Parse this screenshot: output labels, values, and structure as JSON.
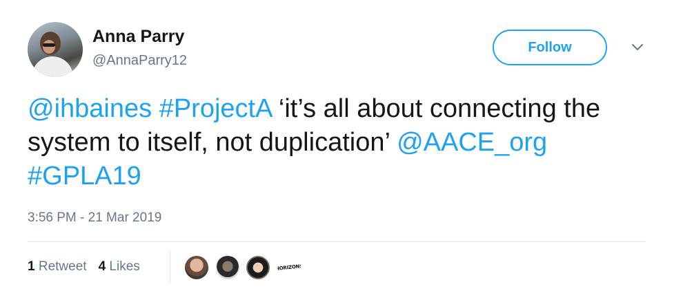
{
  "author": {
    "name": "Anna Parry",
    "handle": "@AnnaParry12"
  },
  "follow_label": "Follow",
  "tweet": {
    "mention1": "@ihbaines",
    "hashtag1": "#ProjectA",
    "text1": " ‘it’s all about connecting the system to itself, not duplication’ ",
    "mention2": "@AACE_org",
    "hashtag2": "#GPLA19"
  },
  "timestamp": "3:56 PM - 21 Mar 2019",
  "stats": {
    "retweets_count": "1",
    "retweets_label": "Retweet",
    "likes_count": "4",
    "likes_label": "Likes"
  },
  "likers": {
    "logo_text": "HORIZONS"
  },
  "colors": {
    "accent": "#1da1f2",
    "secondary_text": "#657786",
    "primary_text": "#14171a"
  }
}
